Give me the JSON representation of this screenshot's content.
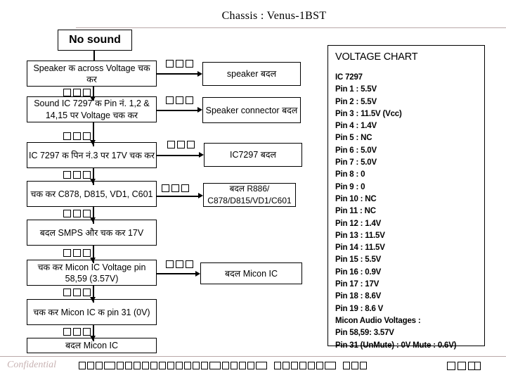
{
  "header": {
    "title": "Chassis : Venus-1BST"
  },
  "flow": {
    "start_box": {
      "label": "No sound"
    },
    "left_column": [
      {
        "id": "check-speaker-voltage",
        "label": "Speaker क  across Voltage चक  कर"
      },
      {
        "id": "check-ic7297-pins",
        "label": "Sound IC 7297 क   Pin नं. 1,2 & 14,15 पर Voltage चक  कर"
      },
      {
        "id": "check-ic7297-pin3",
        "label": "IC 7297 क  पिन  नं.3 पर 17V चक  कर"
      },
      {
        "id": "check-components",
        "label": "चक  कर  C878, D815, VD1, C601"
      },
      {
        "id": "replace-smps",
        "label": "बदल  SMPS और चक  कर 17V"
      },
      {
        "id": "check-micon-voltage",
        "label": "चक  कर  Micon IC Voltage  pin 58,59  (3.57V)"
      },
      {
        "id": "check-micon-pin31",
        "label": "चक  कर  Micon IC क  pin 31 (0V)"
      },
      {
        "id": "replace-micon-final",
        "label": "बदल  Micon IC"
      }
    ],
    "right_column": [
      {
        "id": "replace-speaker",
        "label": "speaker बदल"
      },
      {
        "id": "replace-speaker-connector",
        "label": "Speaker connector बदल"
      },
      {
        "id": "replace-ic7297",
        "label": "IC7297 बदल"
      },
      {
        "id": "replace-r886",
        "label": "बदल  R886/ C878/D815/VD1/C601"
      },
      {
        "id": "replace-micon",
        "label": "बदल  Micon IC"
      }
    ],
    "connector_glyph_count": 3
  },
  "voltage_chart": {
    "title": "VOLTAGE CHART",
    "ic_heading": "IC 7297",
    "pins": [
      "Pin 1 : 5.5V",
      "Pin 2 : 5.5V",
      "Pin 3 : 11.5V (Vcc)",
      "Pin 4 :  1.4V",
      "Pin 5 :  NC",
      "Pin 6 : 5.0V",
      "Pin 7 : 5.0V",
      "Pin 8 :   0",
      "Pin 9 :   0",
      "Pin 10 : NC",
      "Pin 11 : NC",
      "Pin 12 : 1.4V",
      "Pin 13 : 11.5V",
      "Pin 14 : 11.5V",
      "Pin 15 : 5.5V",
      "Pin 16 : 0.9V",
      "Pin 17 : 17V",
      "Pin 18 : 8.6V",
      "Pin 19 : 8.6 V"
    ],
    "micon_heading": "Micon Audio Voltages :",
    "micon_pins": [
      "Pin 58,59:  3.57V",
      "Pin 31 (UnMute) :  0V  Mute : 0.6V)"
    ]
  },
  "footer": {
    "confidential": "Confidential"
  },
  "colors": {
    "rule": "#b9a8a8",
    "confidential_text": "#c8b3b3",
    "box_border": "#000000",
    "background": "#ffffff"
  }
}
